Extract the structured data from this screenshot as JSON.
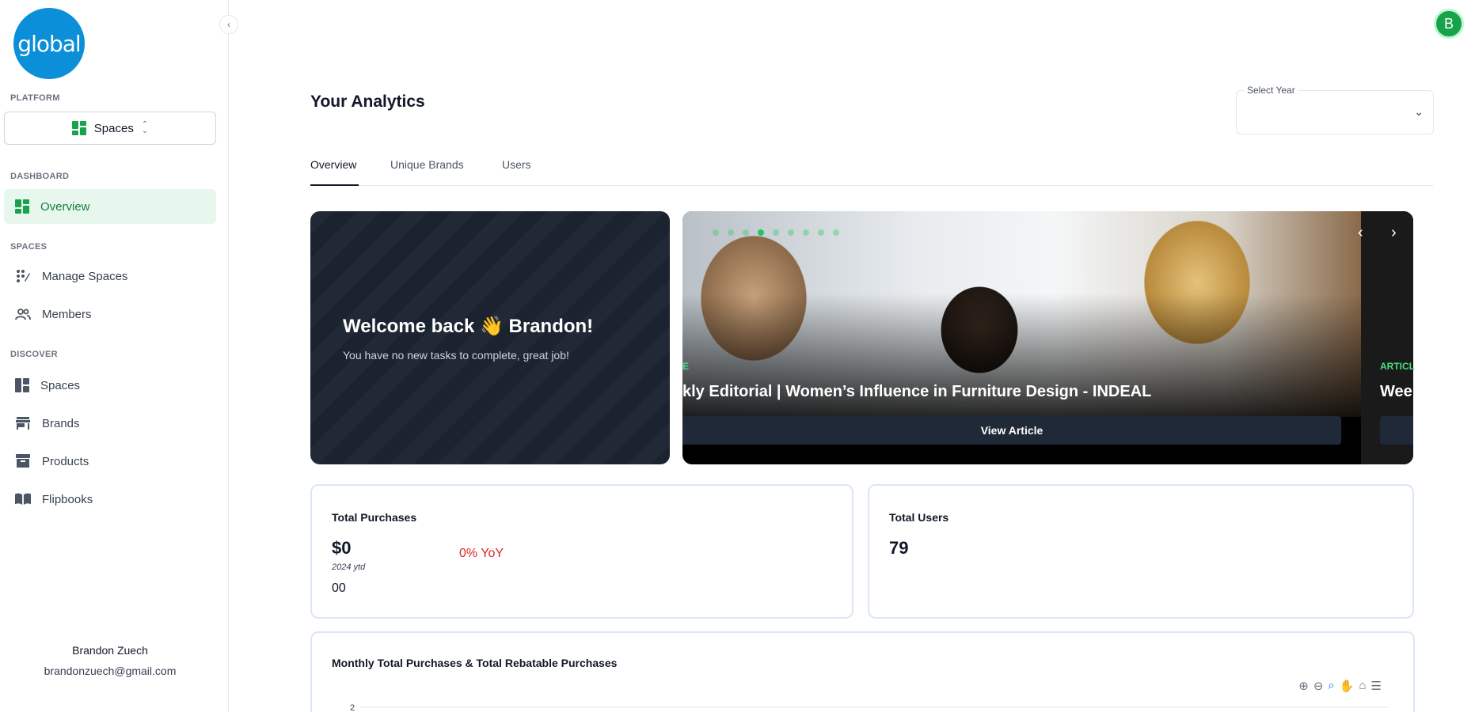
{
  "logo_text": "global",
  "sidebar": {
    "platform_label": "PLATFORM",
    "platform_value": "Spaces",
    "dashboard_label": "DASHBOARD",
    "overview": "Overview",
    "spaces_label": "SPACES",
    "manage_spaces": "Manage Spaces",
    "members": "Members",
    "discover_label": "DISCOVER",
    "discover_spaces": "Spaces",
    "brands": "Brands",
    "products": "Products",
    "flipbooks": "Flipbooks"
  },
  "user": {
    "name": "Brandon Zuech",
    "email": "brandonzuech@gmail.com",
    "initial": "B"
  },
  "page_title": "Your Analytics",
  "year_select": {
    "label": "Select Year",
    "value": ""
  },
  "tabs": [
    "Overview",
    "Unique Brands",
    "Users"
  ],
  "welcome": {
    "title": "Welcome back 👋 Brandon!",
    "subtitle": "You have no new tasks to complete, great job!"
  },
  "article": {
    "tag": "E",
    "title": "kly Editorial | Women’s Influence in Furniture Design - INDEAL",
    "button": "View Article",
    "next_tag": "ARTICL",
    "next_title": "Wee",
    "slide_count": 9,
    "active_slide": 3
  },
  "stats": {
    "purchases_title": "Total Purchases",
    "purchases_value": "$0",
    "purchases_ytd": "2024 ytd",
    "purchases_extra": "00",
    "purchases_yoy": "0% YoY",
    "users_title": "Total Users",
    "users_value": "79"
  },
  "chart": {
    "title": "Monthly Total Purchases & Total Rebatable Purchases",
    "toolbar_icons": [
      "zoom-in-icon",
      "zoom-out-icon",
      "zoom-select-icon",
      "pan-icon",
      "reset-home-icon",
      "menu-icon"
    ]
  },
  "chart_data": {
    "type": "bar",
    "title": "Monthly Total Purchases & Total Rebatable Purchases",
    "y_ticks": [
      "2"
    ],
    "ylim": [
      0,
      2
    ],
    "grid": true
  },
  "colors": {
    "accent": "#16a34a",
    "brand_blue": "#0a8fd8",
    "dark_card": "#1b2230",
    "negative": "#dc2626"
  }
}
